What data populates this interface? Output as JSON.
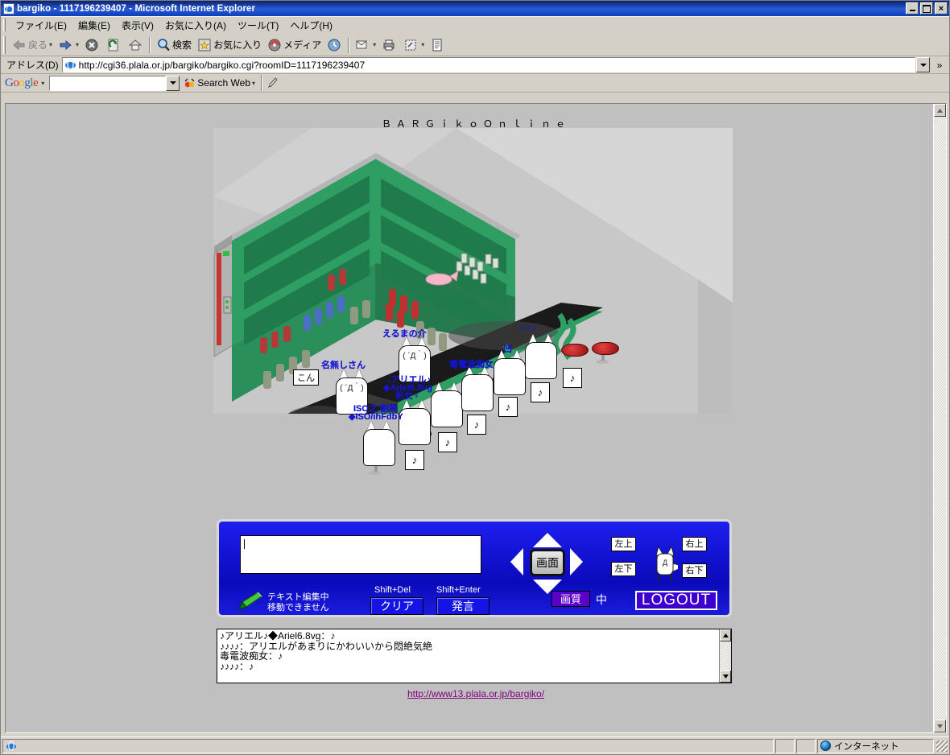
{
  "window": {
    "title": "bargiko - 1117196239407 - Microsoft Internet Explorer",
    "minimize": "_",
    "maximize": "□",
    "close": "×"
  },
  "menu": {
    "items": [
      {
        "label": "ファイル(E)"
      },
      {
        "label": "編集(E)"
      },
      {
        "label": "表示(V)"
      },
      {
        "label": "お気に入り(A)"
      },
      {
        "label": "ツール(T)"
      },
      {
        "label": "ヘルプ(H)"
      }
    ]
  },
  "toolbar": {
    "back": "戻る",
    "forward": "",
    "stop": "",
    "refresh": "",
    "home": "",
    "search": "検索",
    "favorites": "お気に入り",
    "media": "メディア",
    "history": "",
    "mail": "",
    "print": "",
    "edit": "",
    "discuss": ""
  },
  "address": {
    "label": "アドレス(D)",
    "url": "http://cgi36.plala.or.jp/bargiko/bargiko.cgi?roomID=1117196239407"
  },
  "google": {
    "logo": [
      "G",
      "o",
      "o",
      "g",
      "l",
      "e"
    ],
    "query": "",
    "search_web": "Search Web"
  },
  "page": {
    "game_title": "ＢＡＲＧｉｋｏＯｎｌｉｎｅ",
    "footer_link": "http://www13.plala.or.jp/bargiko/",
    "characters": [
      {
        "name": "名無しさん",
        "bubble": "こん",
        "face": "( ´Д｀)",
        "tail": "〜"
      },
      {
        "name": "えるまの介",
        "bubble": "",
        "face": "( ´Д｀)",
        "tail": "〜"
      },
      {
        "name": "ISO之 割男",
        "name2": "◆ISO/ihFdbY",
        "note": "♪",
        "face": "",
        "tail": ""
      },
      {
        "name": "彩女♀",
        "note": "♪",
        "face": "",
        "tail": ""
      },
      {
        "name": "♪アリエル♪",
        "name2": "◆Ariel6.8vg",
        "note": "♪",
        "face": "",
        "tail": ""
      },
      {
        "name": "毒電波痴女",
        "note": "♪",
        "face": "",
        "tail": ""
      },
      {
        "name": "凹",
        "note": "♪",
        "face": "",
        "tail": ""
      },
      {
        "name": "♪♪♪♪",
        "note": "♪",
        "face": "",
        "tail": ""
      }
    ],
    "log_lines": [
      "♪アリエル♪◆Ariel6.8vg：♪",
      "♪♪♪♪：アリエルがあまりにかわいいから悶絶気絶",
      "毒電波痴女：♪",
      "♪♪♪♪：♪"
    ]
  },
  "panel": {
    "input_value": "",
    "status_line1": "テキスト編集中",
    "status_line2": "移動できません",
    "clear_hint": "Shift+Del",
    "clear_label": "クリア",
    "send_hint": "Shift+Enter",
    "send_label": "発言",
    "screen_label": "画面",
    "quality_label": "画質",
    "quality_value": "中",
    "pos_upleft": "左上",
    "pos_upright": "右上",
    "pos_downleft": "左下",
    "pos_downright": "右下",
    "logout_label": "LOGOUT"
  },
  "status": {
    "left": "",
    "zone": "インターネット"
  },
  "colors": {
    "title_blue": "#0a246a",
    "panel_blue": "#1414e6",
    "name_blue": "#1414d2",
    "shelf_green": "#2e9e63",
    "link_purple": "#800080"
  }
}
